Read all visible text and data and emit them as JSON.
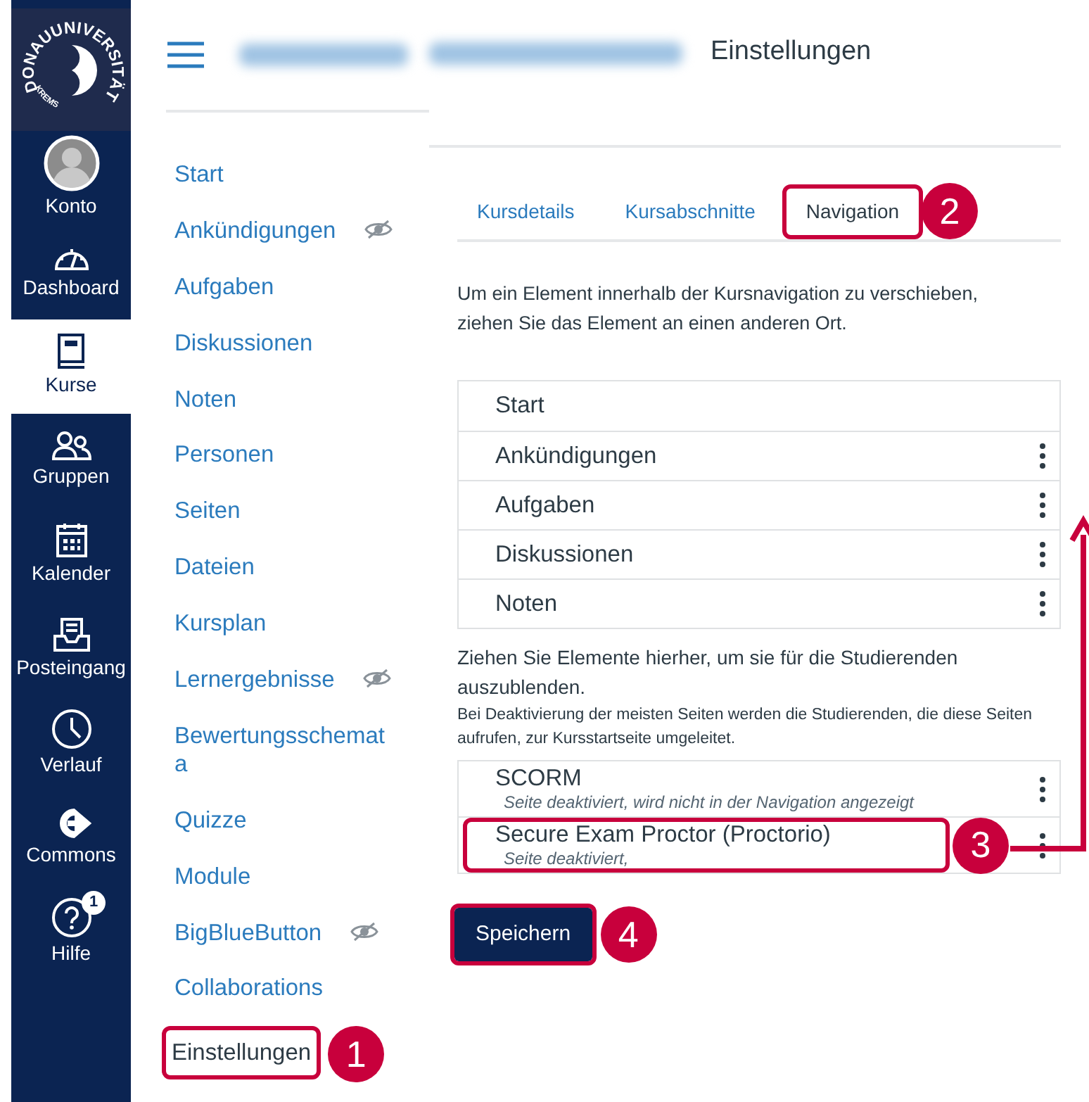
{
  "logo": {
    "arc_text": "DONAUUNIVERSITÄT",
    "small_text": "KREMS"
  },
  "global_nav": [
    {
      "label": "Konto",
      "selected": false
    },
    {
      "label": "Dashboard",
      "selected": false
    },
    {
      "label": "Kurse",
      "selected": true
    },
    {
      "label": "Gruppen",
      "selected": false
    },
    {
      "label": "Kalender",
      "selected": false
    },
    {
      "label": "Posteingang",
      "selected": false
    },
    {
      "label": "Verlauf",
      "selected": false
    },
    {
      "label": "Commons",
      "selected": false
    },
    {
      "label": "Hilfe",
      "selected": false,
      "badge": "1"
    }
  ],
  "course_nav": [
    {
      "label": "Start",
      "hidden": false,
      "selected": false
    },
    {
      "label": "Ankündigungen",
      "hidden": true,
      "selected": false
    },
    {
      "label": "Aufgaben",
      "hidden": false,
      "selected": false
    },
    {
      "label": "Diskussionen",
      "hidden": false,
      "selected": false
    },
    {
      "label": "Noten",
      "hidden": false,
      "selected": false
    },
    {
      "label": "Personen",
      "hidden": false,
      "selected": false
    },
    {
      "label": "Seiten",
      "hidden": false,
      "selected": false
    },
    {
      "label": "Dateien",
      "hidden": false,
      "selected": false
    },
    {
      "label": "Kursplan",
      "hidden": false,
      "selected": false
    },
    {
      "label": "Lernergebnisse",
      "hidden": true,
      "selected": false
    },
    {
      "label": "Bewertungsschemata",
      "hidden": false,
      "selected": false
    },
    {
      "label": "Quizze",
      "hidden": false,
      "selected": false
    },
    {
      "label": "Module",
      "hidden": false,
      "selected": false
    },
    {
      "label": "BigBlueButton",
      "hidden": true,
      "selected": false
    },
    {
      "label": "Collaborations",
      "hidden": false,
      "selected": false
    },
    {
      "label": "Einstellungen",
      "hidden": false,
      "selected": true,
      "callout": "1"
    }
  ],
  "page_title": "Einstellungen",
  "tabs": [
    {
      "label": "Kursdetails",
      "selected": false
    },
    {
      "label": "Kursabschnitte",
      "selected": false
    },
    {
      "label": "Navigation",
      "selected": true,
      "callout": "2"
    }
  ],
  "instructions": "Um ein Element innerhalb der Kursnavigation zu verschieben, ziehen Sie das Element an einen anderen Ort.",
  "enabled_items": [
    {
      "label": "Start",
      "menu": false
    },
    {
      "label": "Ankündigungen",
      "menu": true
    },
    {
      "label": "Aufgaben",
      "menu": true
    },
    {
      "label": "Diskussionen",
      "menu": true
    },
    {
      "label": "Noten",
      "menu": true
    }
  ],
  "hidden_heading": "Ziehen Sie Elemente hierher, um sie für die Studierenden auszublenden.",
  "hidden_note": "Bei Deaktivierung der meisten Seiten werden die Studierenden, die diese Seiten aufrufen, zur Kursstartseite umgeleitet.",
  "hidden_items": [
    {
      "label": "SCORM",
      "note": "Seite deaktiviert, wird nicht in der Navigation angezeigt",
      "menu": true
    },
    {
      "label": "Secure Exam Proctor (Proctorio)",
      "note": "Seite deaktiviert,",
      "menu": true,
      "callout": "3"
    }
  ],
  "save_button": {
    "label": "Speichern",
    "callout": "4"
  }
}
